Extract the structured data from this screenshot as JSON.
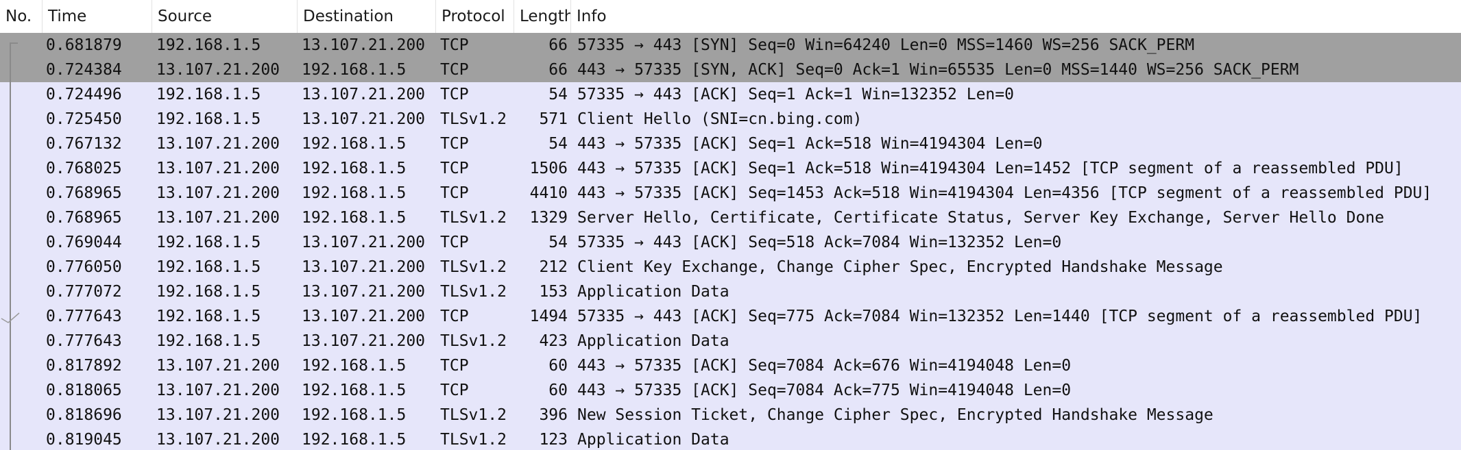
{
  "columns": {
    "no": "No.",
    "time": "Time",
    "source": "Source",
    "destination": "Destination",
    "protocol": "Protocol",
    "length": "Length",
    "info": "Info"
  },
  "packets": [
    {
      "time": "0.681879",
      "source": "192.168.1.5",
      "destination": "13.107.21.200",
      "protocol": "TCP",
      "length": "66",
      "info": "57335 → 443 [SYN] Seq=0 Win=64240 Len=0 MSS=1460 WS=256 SACK_PERM"
    },
    {
      "time": "0.724384",
      "source": "13.107.21.200",
      "destination": "192.168.1.5",
      "protocol": "TCP",
      "length": "66",
      "info": "443 → 57335 [SYN, ACK] Seq=0 Ack=1 Win=65535 Len=0 MSS=1440 WS=256 SACK_PERM"
    },
    {
      "time": "0.724496",
      "source": "192.168.1.5",
      "destination": "13.107.21.200",
      "protocol": "TCP",
      "length": "54",
      "info": "57335 → 443 [ACK] Seq=1 Ack=1 Win=132352 Len=0"
    },
    {
      "time": "0.725450",
      "source": "192.168.1.5",
      "destination": "13.107.21.200",
      "protocol": "TLSv1.2",
      "length": "571",
      "info": "Client Hello (SNI=cn.bing.com)"
    },
    {
      "time": "0.767132",
      "source": "13.107.21.200",
      "destination": "192.168.1.5",
      "protocol": "TCP",
      "length": "54",
      "info": "443 → 57335 [ACK] Seq=1 Ack=518 Win=4194304 Len=0"
    },
    {
      "time": "0.768025",
      "source": "13.107.21.200",
      "destination": "192.168.1.5",
      "protocol": "TCP",
      "length": "1506",
      "info": "443 → 57335 [ACK] Seq=1 Ack=518 Win=4194304 Len=1452 [TCP segment of a reassembled PDU]"
    },
    {
      "time": "0.768965",
      "source": "13.107.21.200",
      "destination": "192.168.1.5",
      "protocol": "TCP",
      "length": "4410",
      "info": "443 → 57335 [ACK] Seq=1453 Ack=518 Win=4194304 Len=4356 [TCP segment of a reassembled PDU]"
    },
    {
      "time": "0.768965",
      "source": "13.107.21.200",
      "destination": "192.168.1.5",
      "protocol": "TLSv1.2",
      "length": "1329",
      "info": "Server Hello, Certificate, Certificate Status, Server Key Exchange, Server Hello Done"
    },
    {
      "time": "0.769044",
      "source": "192.168.1.5",
      "destination": "13.107.21.200",
      "protocol": "TCP",
      "length": "54",
      "info": "57335 → 443 [ACK] Seq=518 Ack=7084 Win=132352 Len=0"
    },
    {
      "time": "0.776050",
      "source": "192.168.1.5",
      "destination": "13.107.21.200",
      "protocol": "TLSv1.2",
      "length": "212",
      "info": "Client Key Exchange, Change Cipher Spec, Encrypted Handshake Message"
    },
    {
      "time": "0.777072",
      "source": "192.168.1.5",
      "destination": "13.107.21.200",
      "protocol": "TLSv1.2",
      "length": "153",
      "info": "Application Data"
    },
    {
      "time": "0.777643",
      "source": "192.168.1.5",
      "destination": "13.107.21.200",
      "protocol": "TCP",
      "length": "1494",
      "info": "57335 → 443 [ACK] Seq=775 Ack=7084 Win=132352 Len=1440 [TCP segment of a reassembled PDU]"
    },
    {
      "time": "0.777643",
      "source": "192.168.1.5",
      "destination": "13.107.21.200",
      "protocol": "TLSv1.2",
      "length": "423",
      "info": "Application Data"
    },
    {
      "time": "0.817892",
      "source": "13.107.21.200",
      "destination": "192.168.1.5",
      "protocol": "TCP",
      "length": "60",
      "info": "443 → 57335 [ACK] Seq=7084 Ack=676 Win=4194048 Len=0"
    },
    {
      "time": "0.818065",
      "source": "13.107.21.200",
      "destination": "192.168.1.5",
      "protocol": "TCP",
      "length": "60",
      "info": "443 → 57335 [ACK] Seq=7084 Ack=775 Win=4194048 Len=0"
    },
    {
      "time": "0.818696",
      "source": "13.107.21.200",
      "destination": "192.168.1.5",
      "protocol": "TLSv1.2",
      "length": "396",
      "info": "New Session Ticket, Change Cipher Spec, Encrypted Handshake Message"
    },
    {
      "time": "0.819045",
      "source": "13.107.21.200",
      "destination": "192.168.1.5",
      "protocol": "TLSv1.2",
      "length": "123",
      "info": "Application Data"
    }
  ],
  "selected_rows": [
    0,
    1
  ],
  "colors": {
    "row_background": "#e6e6fa",
    "selected_background": "#a0a0a0",
    "header_background": "#ffffff",
    "related_line": "#8a8a8a"
  },
  "icons": {
    "related_packets": "related-packets-line-icon",
    "ack_marker": "ack-checkmark-icon"
  }
}
